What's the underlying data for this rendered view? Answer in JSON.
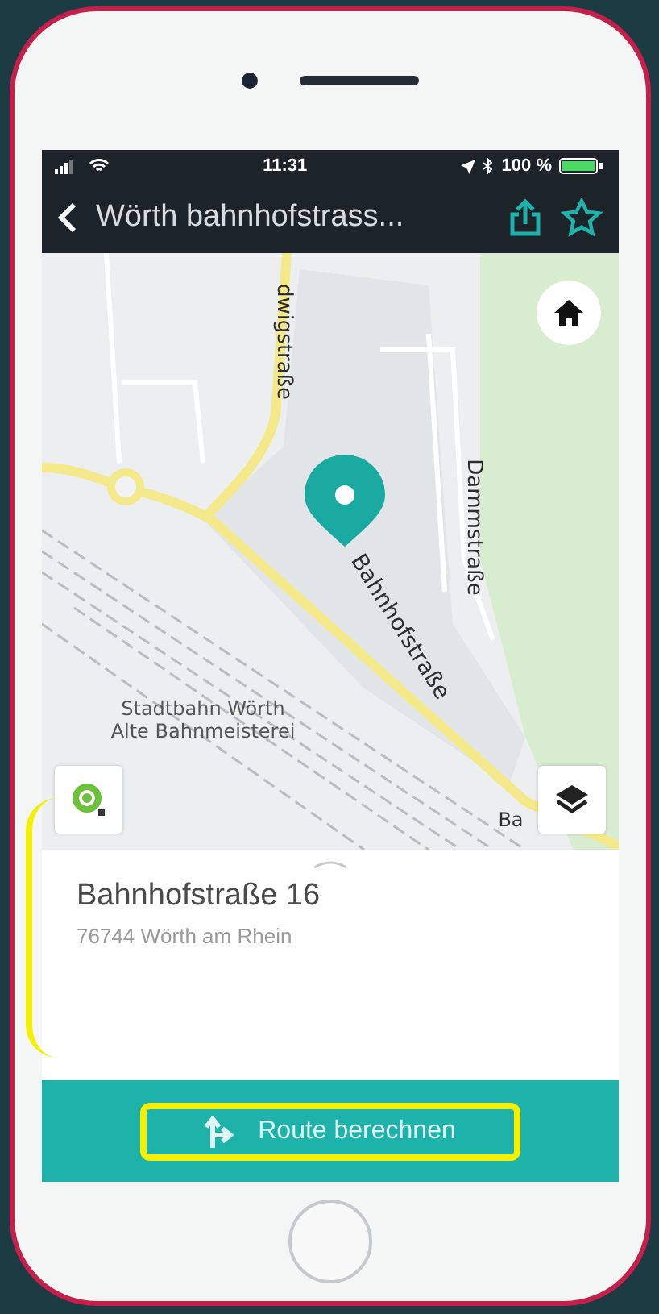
{
  "status_bar": {
    "time": "11:31",
    "battery": "100 %"
  },
  "nav_bar": {
    "title": "Wörth bahnhofstrass..."
  },
  "map": {
    "labels": [
      {
        "text": "dwigstraße",
        "kind": "street"
      },
      {
        "text": "Dammstraße",
        "kind": "street"
      },
      {
        "text": "Bahnhofstraße",
        "kind": "street"
      },
      {
        "text": "Stadtbahn Wörth",
        "kind": "poi"
      },
      {
        "text": "Alte Bahnmeisterei",
        "kind": "poi"
      },
      {
        "text": "Ba",
        "kind": "street"
      }
    ]
  },
  "place": {
    "name": "Bahnhofstraße 16",
    "address": "76744 Wörth am Rhein",
    "annotated": true
  },
  "route_button": {
    "label": "Route berechnen",
    "annotated": true
  }
}
